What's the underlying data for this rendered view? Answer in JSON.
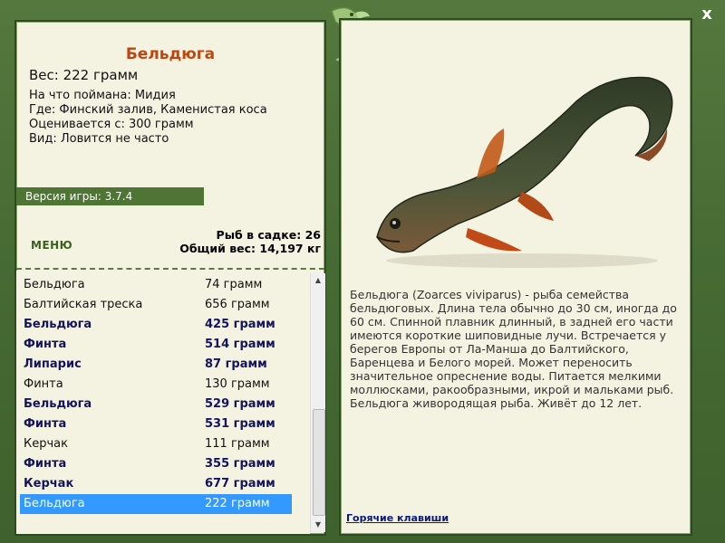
{
  "window": {
    "close_label": "x"
  },
  "fish_card": {
    "title": "Бельдюга",
    "weight": "Вес: 222 грамм",
    "bait": "На что поймана: Мидия",
    "location": "Где: Финский залив, Каменистая коса",
    "rated": "Оценивается с: 300 грамм",
    "rarity": "Вид: Ловится не часто"
  },
  "version": "Версия игры: 3.7.4",
  "menu_label": "МЕНЮ",
  "cage": {
    "count": "Рыб в садке: 26",
    "total": "Общий вес: 14,197 кг"
  },
  "catch_list": [
    {
      "name": "Бельдюга",
      "weight": "74 грамм",
      "style": "normal"
    },
    {
      "name": "Балтийская треска",
      "weight": "656 грамм",
      "style": "normal"
    },
    {
      "name": "Бельдюга",
      "weight": "425 грамм",
      "style": "bold"
    },
    {
      "name": "Финта",
      "weight": "514 грамм",
      "style": "bold"
    },
    {
      "name": "Липарис",
      "weight": "87 грамм",
      "style": "bold"
    },
    {
      "name": "Финта",
      "weight": "130 грамм",
      "style": "normal"
    },
    {
      "name": "Бельдюга",
      "weight": "529 грамм",
      "style": "bold"
    },
    {
      "name": "Финта",
      "weight": "531 грамм",
      "style": "bold"
    },
    {
      "name": "Керчак",
      "weight": "111 грамм",
      "style": "normal"
    },
    {
      "name": "Финта",
      "weight": "355 грамм",
      "style": "bold"
    },
    {
      "name": "Керчак",
      "weight": "677 грамм",
      "style": "bold"
    },
    {
      "name": "Бельдюга",
      "weight": "222 грамм",
      "style": "sel"
    }
  ],
  "description": "Бельдюга (Zoarces viviparus) - рыба семейства бельдюговых. Длина тела обычно до 30 см, иногда до 60 см. Спинной плавник длинный, в задней его части имеются короткие шиповидные лучи. Встречается у берегов Европы от Ла-Манша до Балтийского, Баренцева и Белого морей. Может переносить значительное опреснение воды. Питается мелкими моллюсками, ракообразными, икрой и мальками рыб. Бельдюга живородящая рыба. Живёт до 12 лет.",
  "hotkeys_label": "Горячие клавиши",
  "colors": {
    "frame": "#4a6e36",
    "panel": "#f4f2e1",
    "title": "#c0450e",
    "bold_row": "#14145e",
    "selection": "#3399ff"
  }
}
